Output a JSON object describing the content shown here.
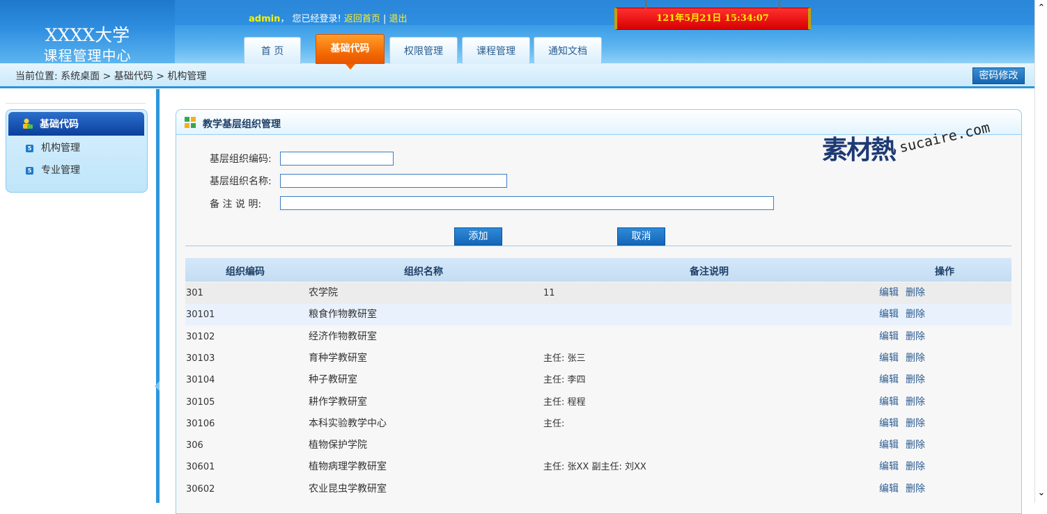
{
  "header": {
    "logo_line1": "XXXX大学",
    "logo_line2": "课程管理中心",
    "username": "admin",
    "logged_in_text": "，  您已经登录!",
    "home_link": "返回首页",
    "separator": "|",
    "logout_link": "退出",
    "clock": "121年5月21日    15:34:07"
  },
  "nav": {
    "tabs": [
      {
        "label": "首    页"
      },
      {
        "label": "基础代码"
      },
      {
        "label": "权限管理"
      },
      {
        "label": "课程管理"
      },
      {
        "label": "通知文档"
      }
    ]
  },
  "breadcrumb": {
    "text": "当前位置:   系统桌面 > 基础代码 > 机构管理",
    "password_button": "密码修改"
  },
  "sidebar": {
    "title": "基础代码",
    "items": [
      {
        "num": "5",
        "label": "机构管理"
      },
      {
        "num": "5",
        "label": "专业管理"
      }
    ]
  },
  "panel": {
    "title": "教学基层组织管理",
    "form": {
      "code_label": "基层组织编码:",
      "name_label": "基层组织名称:",
      "remark_label": "备  注  说  明:",
      "code_value": "",
      "name_value": "",
      "remark_value": "",
      "add_button": "添加",
      "cancel_button": "取消"
    },
    "table": {
      "headers": [
        "组织编码",
        "组织名称",
        "备注说明",
        "操作"
      ],
      "edit_label": "编辑",
      "delete_label": "删除",
      "rows": [
        {
          "code": "301",
          "name": "农学院",
          "remark": "11"
        },
        {
          "code": "30101",
          "name": "粮食作物教研室",
          "remark": ""
        },
        {
          "code": "30102",
          "name": "经济作物教研室",
          "remark": ""
        },
        {
          "code": "30103",
          "name": "育种学教研室",
          "remark": "主任: 张三"
        },
        {
          "code": "30104",
          "name": "种子教研室",
          "remark": "主任: 李四"
        },
        {
          "code": "30105",
          "name": "耕作学教研室",
          "remark": "主任: 程程"
        },
        {
          "code": "30106",
          "name": "本科实验教学中心",
          "remark": "主任:"
        },
        {
          "code": "306",
          "name": "植物保护学院",
          "remark": ""
        },
        {
          "code": "30601",
          "name": "植物病理学教研室",
          "remark": "主任: 张XX 副主任: 刘XX"
        },
        {
          "code": "30602",
          "name": "农业昆虫学教研室",
          "remark": ""
        }
      ]
    }
  },
  "watermark": {
    "zh": "素材熱",
    "en": "sucaire.com"
  },
  "colors": {
    "header_blue": "#2a86d8",
    "active_tab_orange": "#f26400",
    "clock_red": "#e00000",
    "button_blue": "#1f78c8",
    "row_highlight": "#e9f1fd"
  }
}
